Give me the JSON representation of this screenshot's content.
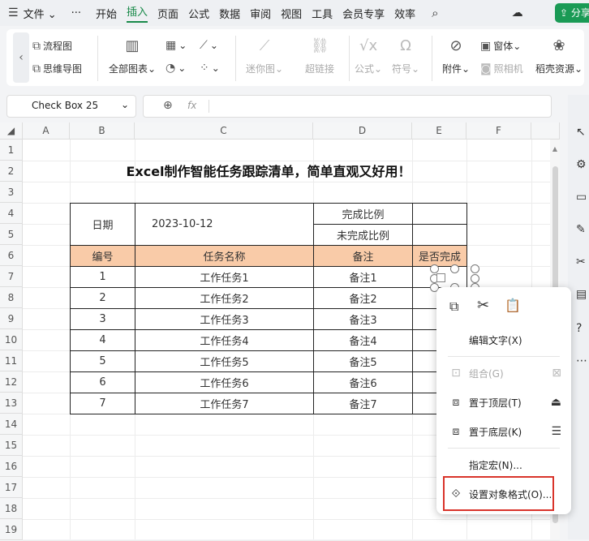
{
  "menubar": {
    "file": "文件",
    "more": "···",
    "tabs": [
      "开始",
      "插入",
      "页面",
      "公式",
      "数据",
      "审阅",
      "视图",
      "工具",
      "会员专享",
      "效率"
    ],
    "share": "分享"
  },
  "ribbon": {
    "flowchart": "流程图",
    "mindmap": "思维导图",
    "all_charts": "全部图表",
    "sparkline": "迷你图",
    "hyperlink": "超链接",
    "formula": "公式",
    "symbol": "符号",
    "attachment": "附件",
    "window": "窗体",
    "camera": "照相机",
    "resource": "稻壳资源"
  },
  "formula_bar": {
    "namebox": "Check Box 25",
    "fx": "fx"
  },
  "columns": [
    "A",
    "B",
    "C",
    "D",
    "E",
    "F"
  ],
  "rows": [
    "1",
    "2",
    "3",
    "4",
    "5",
    "6",
    "7",
    "8",
    "9",
    "10",
    "11",
    "12",
    "13",
    "14",
    "15",
    "16",
    "17",
    "18",
    "19"
  ],
  "sheet": {
    "title": "Excel制作智能任务跟踪清单，简单直观又好用！",
    "date_label": "日期",
    "date_value": "2023-10-12",
    "ratio_done": "完成比例",
    "ratio_undone": "未完成比例",
    "headers": [
      "编号",
      "任务名称",
      "备注",
      "是否完成"
    ],
    "tasks": [
      {
        "no": "1",
        "name": "工作任务1",
        "note": "备注1"
      },
      {
        "no": "2",
        "name": "工作任务2",
        "note": "备注2"
      },
      {
        "no": "3",
        "name": "工作任务3",
        "note": "备注3"
      },
      {
        "no": "4",
        "name": "工作任务4",
        "note": "备注4"
      },
      {
        "no": "5",
        "name": "工作任务5",
        "note": "备注5"
      },
      {
        "no": "6",
        "name": "工作任务6",
        "note": "备注6"
      },
      {
        "no": "7",
        "name": "工作任务7",
        "note": "备注7"
      }
    ]
  },
  "context_menu": {
    "edit_text": "编辑文字(X)",
    "group": "组合(G)",
    "bring_top": "置于顶层(T)",
    "send_bottom": "置于底层(K)",
    "assign_macro": "指定宏(N)...",
    "format_object": "设置对象格式(O)..."
  }
}
